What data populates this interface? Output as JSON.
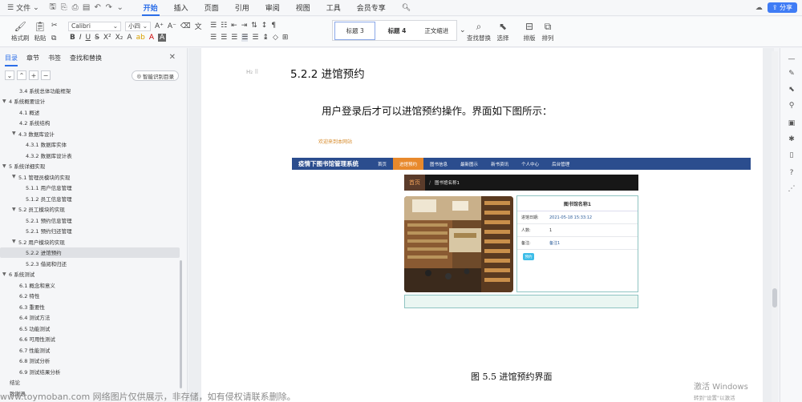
{
  "menubar": {
    "file_label": "文件",
    "tabs": [
      "开始",
      "插入",
      "页面",
      "引用",
      "审阅",
      "视图",
      "工具",
      "会员专享"
    ],
    "share_label": "分享"
  },
  "ribbon": {
    "format_painter": "格式刷",
    "paste": "粘贴",
    "font_name": "Calibri",
    "font_size": "小四",
    "styles": [
      "标题 3",
      "标题 4",
      "正文缩进"
    ],
    "find_replace": "查找替换",
    "select": "选择",
    "layout": "排版",
    "arrange": "排列"
  },
  "sidebar": {
    "tabs": [
      "目录",
      "章节",
      "书签",
      "查找和替换"
    ],
    "smart_toc": "智能识别目录",
    "outline": [
      {
        "label": "3.4 系统总体功能框架",
        "level": 2,
        "arrow": ""
      },
      {
        "label": "4 系统概要设计",
        "level": 1,
        "arrow": "▼"
      },
      {
        "label": "4.1 概述",
        "level": 2,
        "arrow": ""
      },
      {
        "label": "4.2 系统结构",
        "level": 2,
        "arrow": ""
      },
      {
        "label": "4.3 数据库设计",
        "level": 2,
        "arrow": "▼"
      },
      {
        "label": "4.3.1 数据库实体",
        "level": 3,
        "arrow": ""
      },
      {
        "label": "4.3.2 数据库设计表",
        "level": 3,
        "arrow": ""
      },
      {
        "label": "5 系统详细实现",
        "level": 1,
        "arrow": "▼"
      },
      {
        "label": "5.1  管理员模块的实现",
        "level": 2,
        "arrow": "▼"
      },
      {
        "label": "5.1.1  用户信息管理",
        "level": 3,
        "arrow": ""
      },
      {
        "label": "5.1.2  员工信息管理",
        "level": 3,
        "arrow": ""
      },
      {
        "label": "5.2  员工模块的实现",
        "level": 2,
        "arrow": "▼"
      },
      {
        "label": "5.2.1  预约信息管理",
        "level": 3,
        "arrow": ""
      },
      {
        "label": "5.2.1  预约归还管理",
        "level": 3,
        "arrow": ""
      },
      {
        "label": "5.2  用户模块的实现",
        "level": 2,
        "arrow": "▼"
      },
      {
        "label": "5.2.2  进馆预约",
        "level": 3,
        "arrow": "",
        "selected": true
      },
      {
        "label": "5.2.3  借阅和归还",
        "level": 3,
        "arrow": ""
      },
      {
        "label": "6 系统测试",
        "level": 1,
        "arrow": "▼"
      },
      {
        "label": "6.1 概念和意义",
        "level": 2,
        "arrow": ""
      },
      {
        "label": "6.2 特性",
        "level": 2,
        "arrow": ""
      },
      {
        "label": "6.3 重要性",
        "level": 2,
        "arrow": ""
      },
      {
        "label": "6.4 测试方法",
        "level": 2,
        "arrow": ""
      },
      {
        "label": "6.5  功能测试",
        "level": 2,
        "arrow": ""
      },
      {
        "label": "6.6 可用性测试",
        "level": 2,
        "arrow": ""
      },
      {
        "label": "6.7 性能测试",
        "level": 2,
        "arrow": ""
      },
      {
        "label": "6.8 测试分析",
        "level": 2,
        "arrow": ""
      },
      {
        "label": "6.9 测试结果分析",
        "level": 2,
        "arrow": ""
      },
      {
        "label": "结论",
        "level": 1,
        "arrow": ""
      },
      {
        "label": "致谢语",
        "level": 1,
        "arrow": ""
      }
    ]
  },
  "document": {
    "heading_mark": "H₂ ⠿",
    "heading": "5.2.2  进馆预约",
    "paragraph": "用户登录后才可以进馆预约操作。界面如下图所示：",
    "caption": "图 5.5  进馆预约界面",
    "figure": {
      "welcome": "欢迎来到本网站",
      "brand": "疫情下图书馆管理系统",
      "nav": [
        "首页",
        "进馆预约",
        "图书信息",
        "最新图示",
        "新书资讯",
        "个人中心",
        "后台管理"
      ],
      "active_nav": 1,
      "crumb_home": "首页",
      "crumb_sep": "/",
      "crumb_current": "图书馆名称1",
      "card_title": "图书馆名称1",
      "rows": [
        {
          "k": "进馆日期:",
          "v": "2021-05-18 15:33:12"
        },
        {
          "k": "人数:",
          "v": "1"
        },
        {
          "k": "备注:",
          "v": "备注1"
        }
      ],
      "reserve_btn": "预约"
    }
  },
  "watermark": "www.toymoban.com 网络图片仅供展示，非存储，如有侵权请联系删除。",
  "activation": {
    "line1": "激活 Windows",
    "line2": "转到\"设置\"以激活 Windows。"
  }
}
